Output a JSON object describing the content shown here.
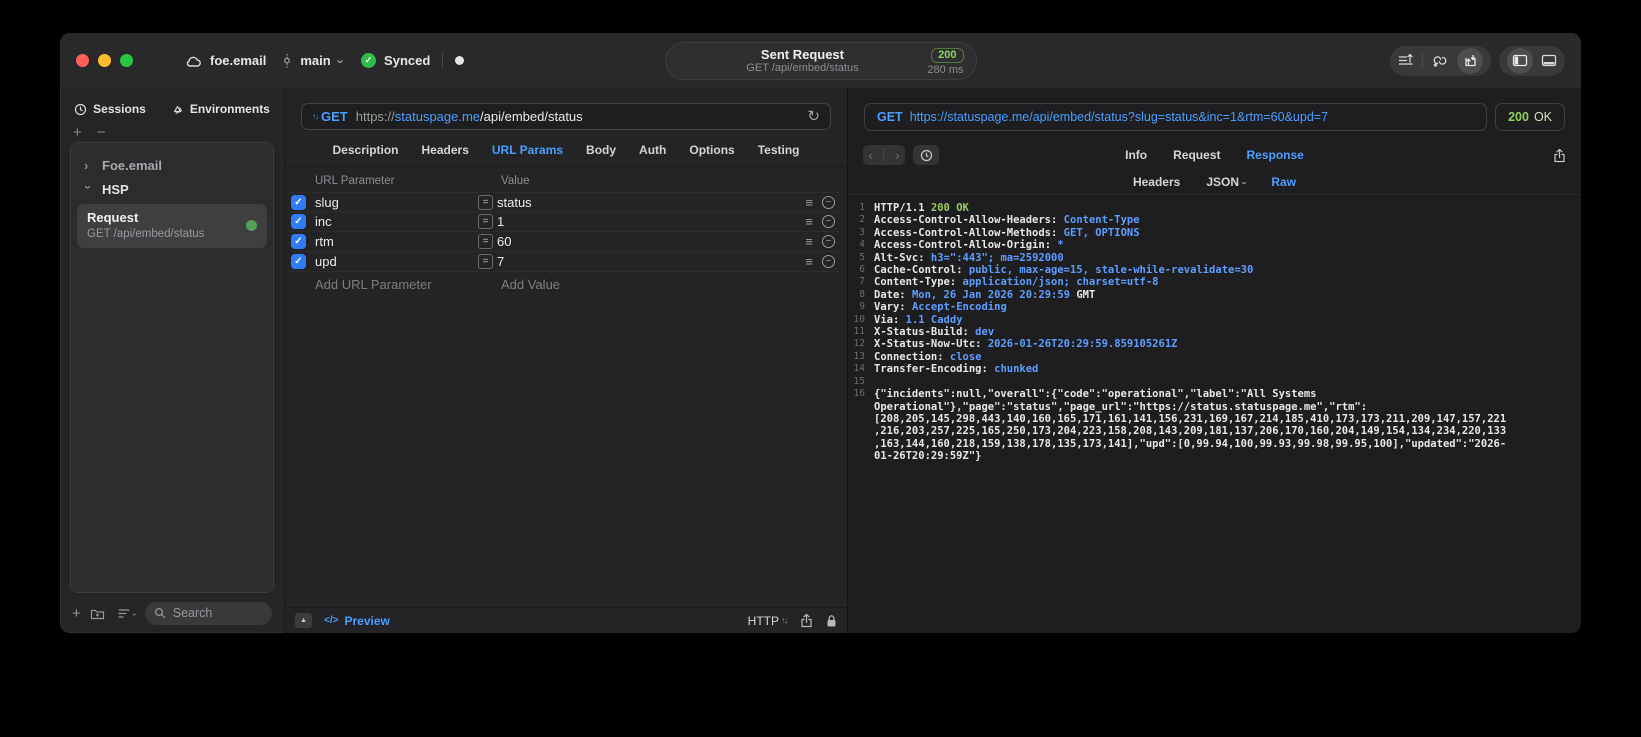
{
  "titlebar": {
    "project": "foe.email",
    "branch": "main",
    "sync_label": "Synced",
    "request_summary": {
      "title": "Sent Request",
      "subtitle": "GET /api/embed/status",
      "status_code": "200",
      "duration": "280 ms"
    },
    "traffic_colors": {
      "close": "#ff5f57",
      "minimize": "#febc2e",
      "zoom": "#28c840"
    },
    "sync_green": "#2ebd4a"
  },
  "sidebar": {
    "tabs": [
      {
        "label": "Sessions",
        "icon": "clock-icon"
      },
      {
        "label": "Environments",
        "icon": "layers-icon"
      }
    ],
    "tree": [
      {
        "label": "Foe.email",
        "state": "collapsed"
      },
      {
        "label": "HSP",
        "state": "expanded"
      }
    ],
    "request_item": {
      "title": "Request",
      "subtitle": "GET /api/embed/status",
      "status_dot_color": "#55a058"
    },
    "search": {
      "placeholder": "Search"
    }
  },
  "request_editor": {
    "method": "GET",
    "url": {
      "scheme": "https://",
      "host": "statuspage.me",
      "path": "/api/embed/status"
    },
    "tabs": [
      "Description",
      "Headers",
      "URL Params",
      "Body",
      "Auth",
      "Options",
      "Testing"
    ],
    "active_tab": "URL Params",
    "params": {
      "columns": [
        "URL Parameter",
        "Value"
      ],
      "rows": [
        {
          "enabled": true,
          "name": "slug",
          "value": "status"
        },
        {
          "enabled": true,
          "name": "inc",
          "value": "1"
        },
        {
          "enabled": true,
          "name": "rtm",
          "value": "60"
        },
        {
          "enabled": true,
          "name": "upd",
          "value": "7"
        }
      ],
      "add_row": {
        "name_placeholder": "Add URL Parameter",
        "value_placeholder": "Add Value"
      }
    },
    "footer": {
      "preview_label": "Preview",
      "code_glyph": "</>",
      "protocol_label": "HTTP"
    }
  },
  "response_viewer": {
    "request_line": {
      "method": "GET",
      "url": "https://statuspage.me/api/embed/status?slug=status&inc=1&rtm=60&upd=7"
    },
    "status": {
      "code": "200",
      "reason": "OK"
    },
    "tabs": [
      "Info",
      "Request",
      "Response"
    ],
    "active_tab": "Response",
    "subtabs": [
      {
        "label": "Headers",
        "dropdown": false
      },
      {
        "label": "JSON",
        "dropdown": true
      },
      {
        "label": "Raw",
        "dropdown": false
      }
    ],
    "active_subtab": "Raw",
    "colors": {
      "key": "#e8e8e8",
      "value": "#5e9eff",
      "status_green": "#9ccb66",
      "accent_blue": "#4b9fff"
    },
    "body_lines": [
      {
        "n": 1,
        "segs": [
          [
            "p",
            "HTTP/1.1 "
          ],
          [
            "g",
            "200 OK"
          ]
        ]
      },
      {
        "n": 2,
        "segs": [
          [
            "k",
            "Access-Control-Allow-Headers"
          ],
          [
            "p",
            ": "
          ],
          [
            "v",
            "Content-Type"
          ]
        ]
      },
      {
        "n": 3,
        "segs": [
          [
            "k",
            "Access-Control-Allow-Methods"
          ],
          [
            "p",
            ": "
          ],
          [
            "v",
            "GET, OPTIONS"
          ]
        ]
      },
      {
        "n": 4,
        "segs": [
          [
            "k",
            "Access-Control-Allow-Origin"
          ],
          [
            "p",
            ": "
          ],
          [
            "v",
            "*"
          ]
        ]
      },
      {
        "n": 5,
        "segs": [
          [
            "k",
            "Alt-Svc"
          ],
          [
            "p",
            ": "
          ],
          [
            "v",
            "h3=\":443\"; ma=2592000"
          ]
        ]
      },
      {
        "n": 6,
        "segs": [
          [
            "k",
            "Cache-Control"
          ],
          [
            "p",
            ": "
          ],
          [
            "v",
            "public, max-age=15, stale-while-revalidate=30"
          ]
        ]
      },
      {
        "n": 7,
        "segs": [
          [
            "k",
            "Content-Type"
          ],
          [
            "p",
            ": "
          ],
          [
            "v",
            "application/json; charset=utf-8"
          ]
        ]
      },
      {
        "n": 8,
        "segs": [
          [
            "k",
            "Date"
          ],
          [
            "p",
            ": "
          ],
          [
            "v",
            "Mon, 26 Jan 2026 20:29:59 "
          ],
          [
            "p",
            "GMT"
          ]
        ]
      },
      {
        "n": 9,
        "segs": [
          [
            "k",
            "Vary"
          ],
          [
            "p",
            ": "
          ],
          [
            "v",
            "Accept-Encoding"
          ]
        ]
      },
      {
        "n": 10,
        "segs": [
          [
            "k",
            "Via"
          ],
          [
            "p",
            ": "
          ],
          [
            "v",
            "1.1 Caddy"
          ]
        ]
      },
      {
        "n": 11,
        "segs": [
          [
            "k",
            "X-Status-Build"
          ],
          [
            "p",
            ": "
          ],
          [
            "v",
            "dev"
          ]
        ]
      },
      {
        "n": 12,
        "segs": [
          [
            "k",
            "X-Status-Now-Utc"
          ],
          [
            "p",
            ": "
          ],
          [
            "v",
            "2026-01-26T20:29:59.859105261Z"
          ]
        ]
      },
      {
        "n": 13,
        "segs": [
          [
            "k",
            "Connection"
          ],
          [
            "p",
            ": "
          ],
          [
            "v",
            "close"
          ]
        ]
      },
      {
        "n": 14,
        "segs": [
          [
            "k",
            "Transfer-Encoding"
          ],
          [
            "p",
            ": "
          ],
          [
            "v",
            "chunked"
          ]
        ]
      },
      {
        "n": 15,
        "segs": []
      },
      {
        "n": 16,
        "segs": [
          [
            "p",
            "{\"incidents\":null,\"overall\":{\"code\":\"operational\",\"label\":\"All Systems Operational\"},\"page\":\"status\",\"page_url\":\"https://status.statuspage.me\",\"rtm\":[208,205,145,298,443,140,160,165,171,161,141,156,231,169,167,214,185,410,173,173,211,209,147,157,221,216,203,257,225,165,250,173,204,223,158,208,143,209,181,137,206,170,160,204,149,154,134,234,220,133,163,144,160,218,159,138,178,135,173,141],\"upd\":[0,99.94,100,99.93,99.98,99.95,100],\"updated\":\"2026-01-26T20:29:59Z\"}"
          ]
        ]
      }
    ]
  }
}
